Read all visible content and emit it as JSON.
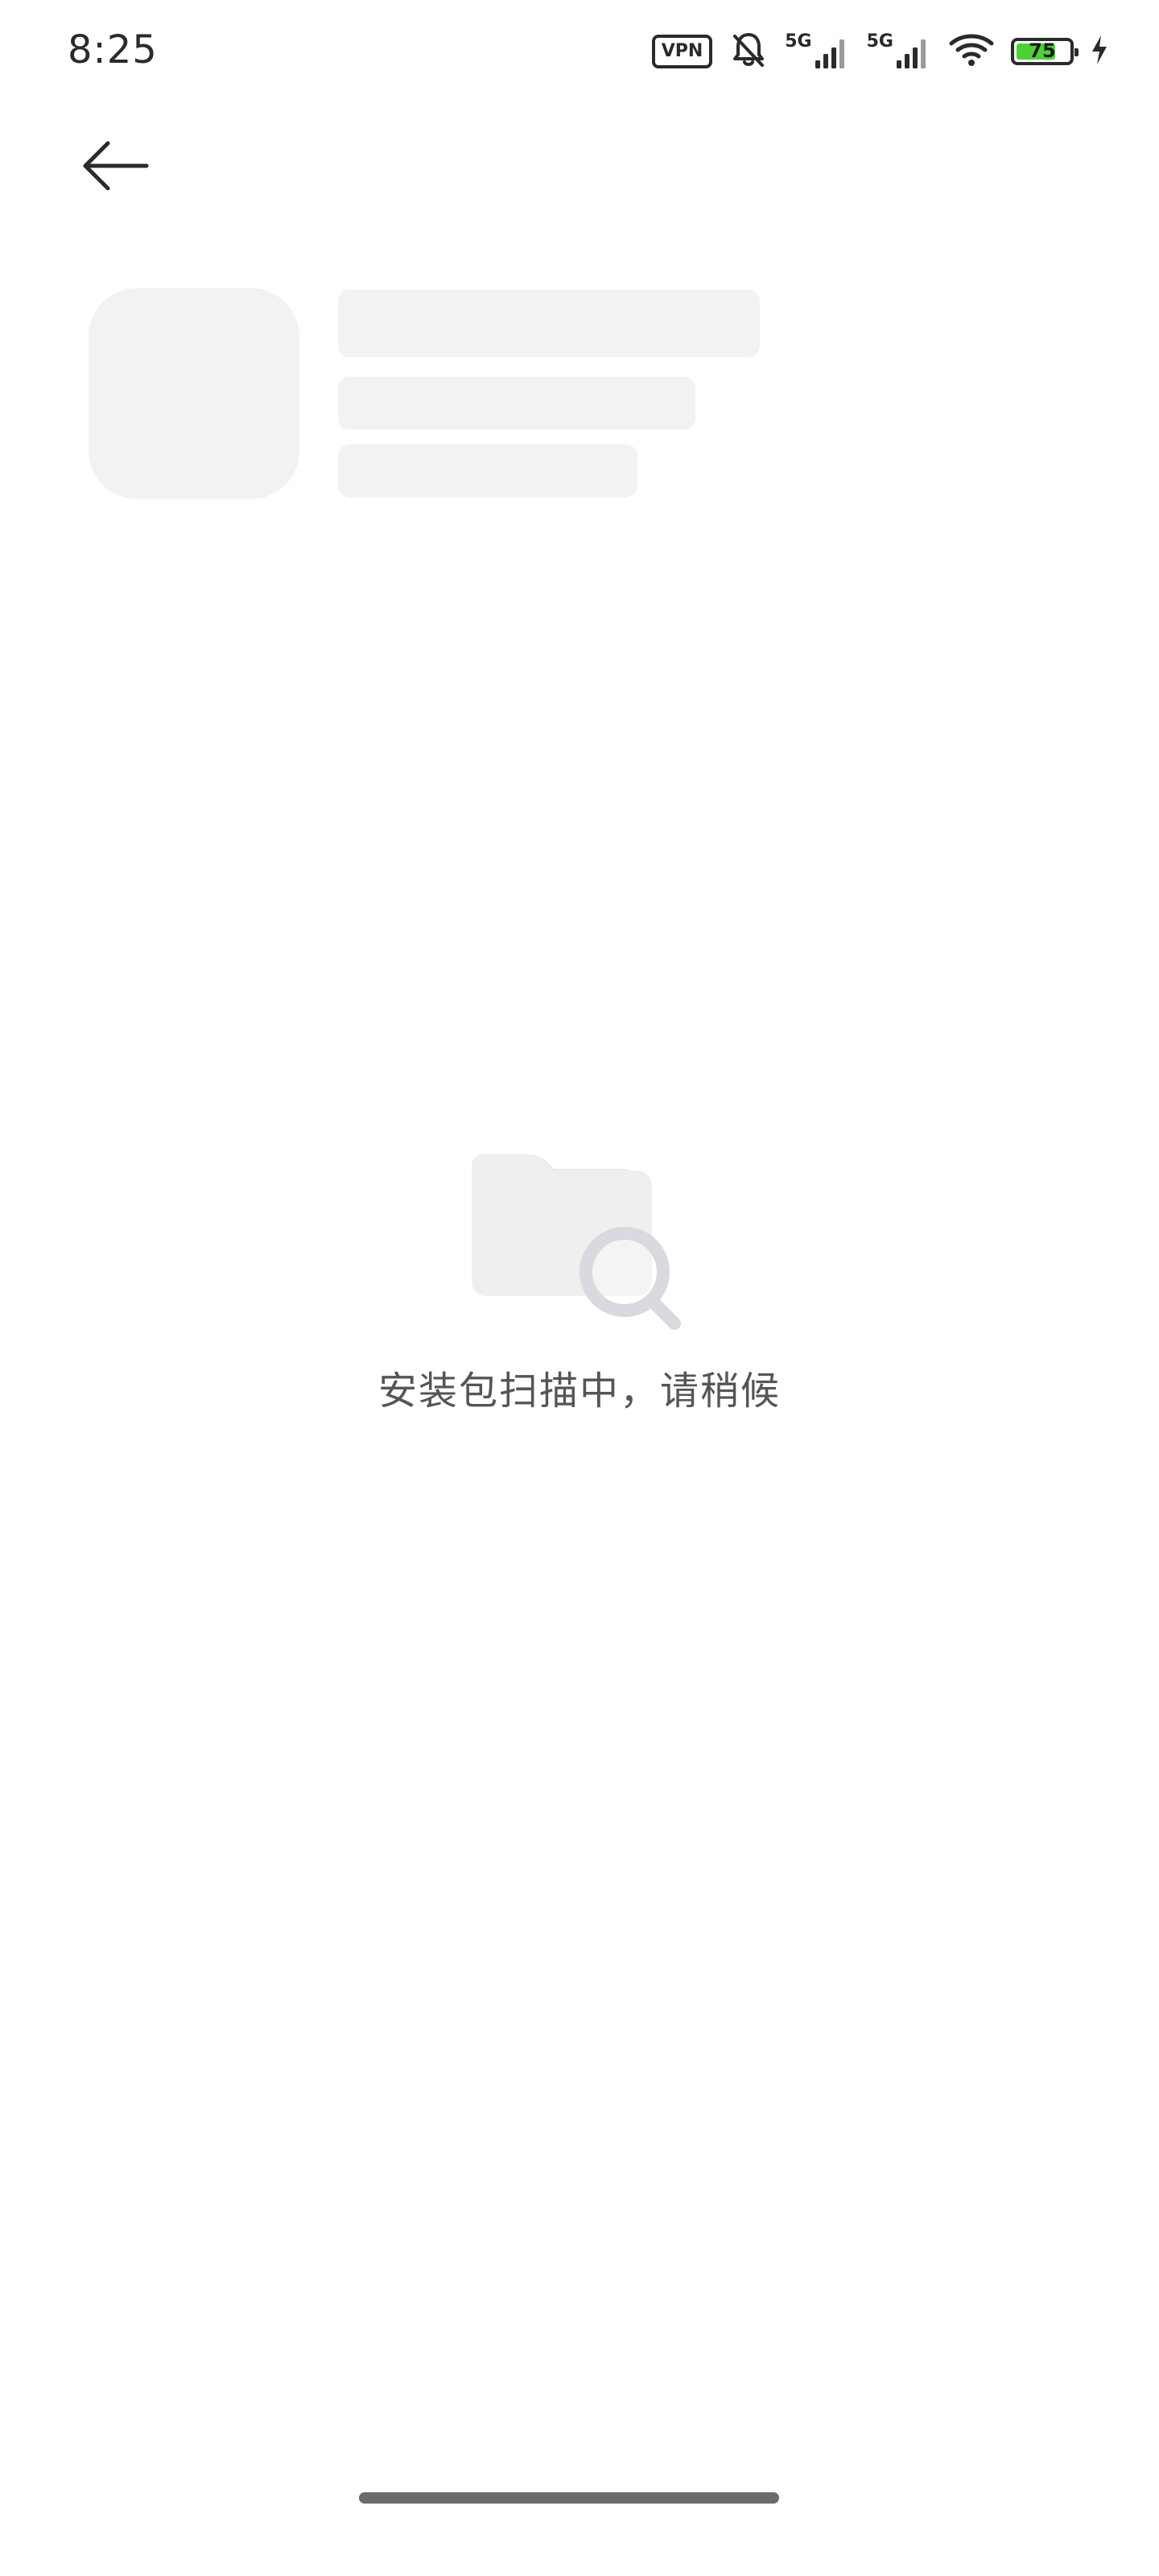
{
  "status_bar": {
    "time": "8:25",
    "vpn_label": "VPN",
    "signal_1_label": "5G",
    "signal_2_label": "5G",
    "battery_level": "75",
    "battery_fraction": 0.75,
    "battery_color": "#4cd137"
  },
  "header": {
    "back_icon": "arrow-left-icon"
  },
  "scan_state": {
    "icon": "folder-search-icon",
    "message": "安装包扫描中，请稍候"
  }
}
